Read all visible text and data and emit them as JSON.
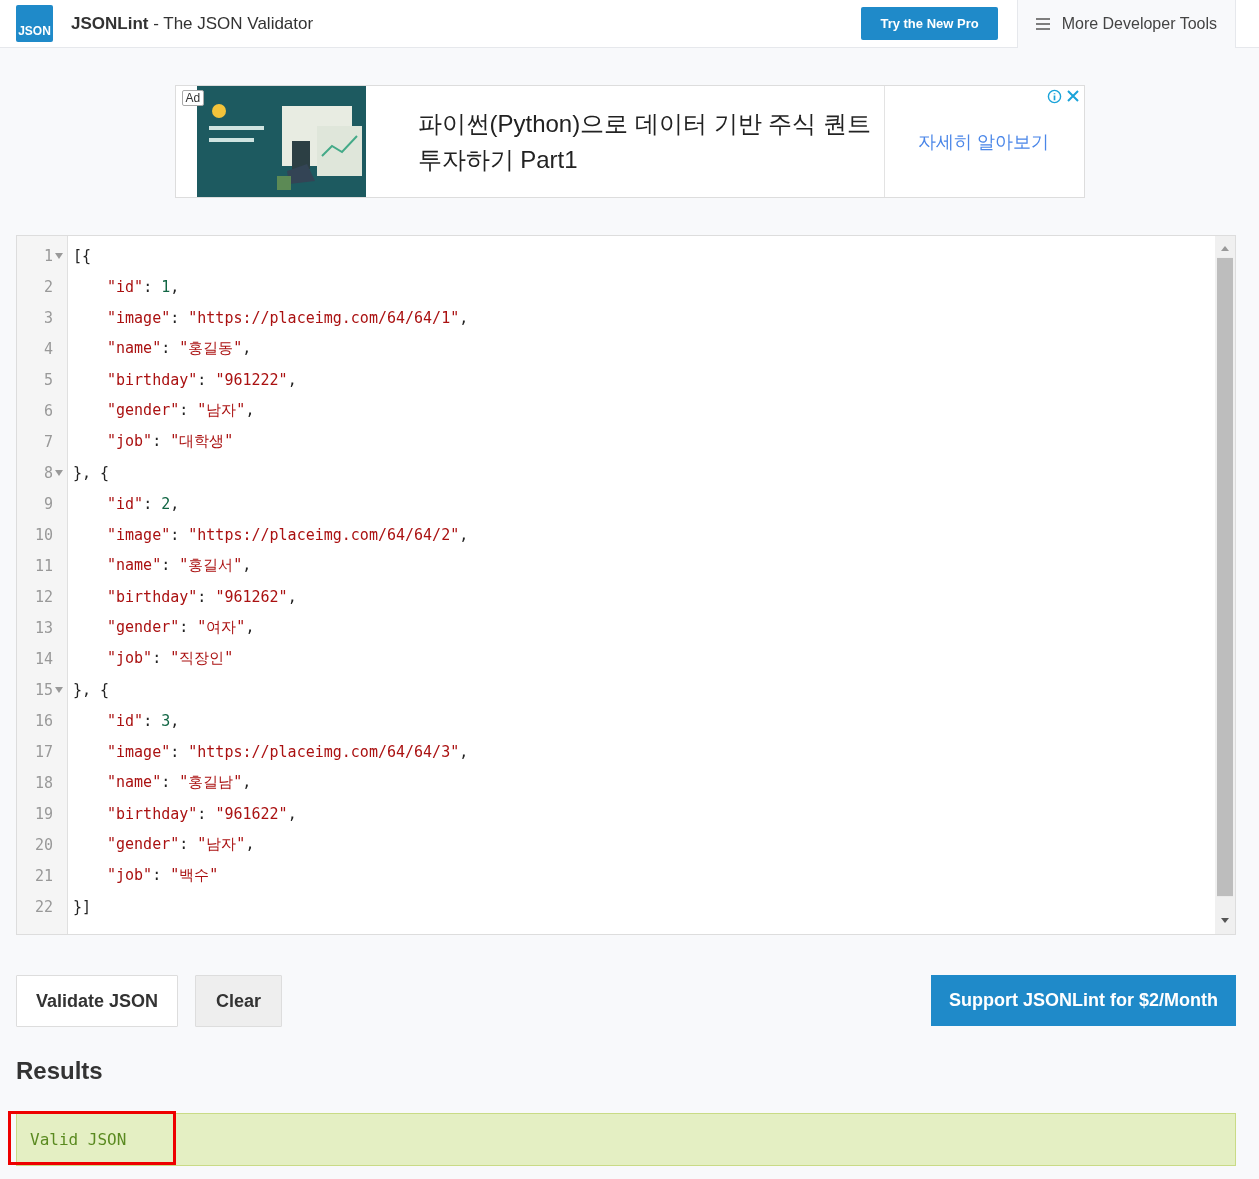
{
  "header": {
    "logo": "JSON",
    "brand": "JSONLint",
    "tagline": " - The JSON Validator",
    "pro_button": "Try the New Pro",
    "tools_button": "More Developer Tools"
  },
  "ad": {
    "badge": "Ad",
    "kind": "picture",
    "title": "파이썬(Python)으로 데이터 기반 주식 퀀트 투자하기 Part1",
    "link": "자세히 알아보기"
  },
  "editor": {
    "lines": [
      {
        "number": "1",
        "fold": true,
        "kind": "bracket",
        "tokens": [
          {
            "kind": "punct",
            "text": "[{"
          }
        ]
      },
      {
        "number": "2",
        "fold": false,
        "kind": "property",
        "tokens": [
          {
            "kind": "key",
            "text": "\"id\""
          },
          {
            "kind": "punct",
            "text": ": "
          },
          {
            "kind": "number",
            "text": "1"
          },
          {
            "kind": "punct",
            "text": ","
          }
        ]
      },
      {
        "number": "3",
        "fold": false,
        "kind": "property",
        "tokens": [
          {
            "kind": "key",
            "text": "\"image\""
          },
          {
            "kind": "punct",
            "text": ": "
          },
          {
            "kind": "string",
            "text": "\"https://placeimg.com/64/64/1\""
          },
          {
            "kind": "punct",
            "text": ","
          }
        ]
      },
      {
        "number": "4",
        "fold": false,
        "kind": "property",
        "tokens": [
          {
            "kind": "key",
            "text": "\"name\""
          },
          {
            "kind": "punct",
            "text": ": "
          },
          {
            "kind": "string",
            "text": "\"홍길동\""
          },
          {
            "kind": "punct",
            "text": ","
          }
        ]
      },
      {
        "number": "5",
        "fold": false,
        "kind": "property",
        "tokens": [
          {
            "kind": "key",
            "text": "\"birthday\""
          },
          {
            "kind": "punct",
            "text": ": "
          },
          {
            "kind": "string",
            "text": "\"961222\""
          },
          {
            "kind": "punct",
            "text": ","
          }
        ]
      },
      {
        "number": "6",
        "fold": false,
        "kind": "property",
        "tokens": [
          {
            "kind": "key",
            "text": "\"gender\""
          },
          {
            "kind": "punct",
            "text": ": "
          },
          {
            "kind": "string",
            "text": "\"남자\""
          },
          {
            "kind": "punct",
            "text": ","
          }
        ]
      },
      {
        "number": "7",
        "fold": false,
        "kind": "property",
        "tokens": [
          {
            "kind": "key",
            "text": "\"job\""
          },
          {
            "kind": "punct",
            "text": ": "
          },
          {
            "kind": "string",
            "text": "\"대학생\""
          }
        ]
      },
      {
        "number": "8",
        "fold": true,
        "kind": "bracket",
        "tokens": [
          {
            "kind": "punct",
            "text": "}, {"
          }
        ]
      },
      {
        "number": "9",
        "fold": false,
        "kind": "property",
        "tokens": [
          {
            "kind": "key",
            "text": "\"id\""
          },
          {
            "kind": "punct",
            "text": ": "
          },
          {
            "kind": "number",
            "text": "2"
          },
          {
            "kind": "punct",
            "text": ","
          }
        ]
      },
      {
        "number": "10",
        "fold": false,
        "kind": "property",
        "tokens": [
          {
            "kind": "key",
            "text": "\"image\""
          },
          {
            "kind": "punct",
            "text": ": "
          },
          {
            "kind": "string",
            "text": "\"https://placeimg.com/64/64/2\""
          },
          {
            "kind": "punct",
            "text": ","
          }
        ]
      },
      {
        "number": "11",
        "fold": false,
        "kind": "property",
        "tokens": [
          {
            "kind": "key",
            "text": "\"name\""
          },
          {
            "kind": "punct",
            "text": ": "
          },
          {
            "kind": "string",
            "text": "\"홍길서\""
          },
          {
            "kind": "punct",
            "text": ","
          }
        ]
      },
      {
        "number": "12",
        "fold": false,
        "kind": "property",
        "tokens": [
          {
            "kind": "key",
            "text": "\"birthday\""
          },
          {
            "kind": "punct",
            "text": ": "
          },
          {
            "kind": "string",
            "text": "\"961262\""
          },
          {
            "kind": "punct",
            "text": ","
          }
        ]
      },
      {
        "number": "13",
        "fold": false,
        "kind": "property",
        "tokens": [
          {
            "kind": "key",
            "text": "\"gender\""
          },
          {
            "kind": "punct",
            "text": ": "
          },
          {
            "kind": "string",
            "text": "\"여자\""
          },
          {
            "kind": "punct",
            "text": ","
          }
        ]
      },
      {
        "number": "14",
        "fold": false,
        "kind": "property",
        "tokens": [
          {
            "kind": "key",
            "text": "\"job\""
          },
          {
            "kind": "punct",
            "text": ": "
          },
          {
            "kind": "string",
            "text": "\"직장인\""
          }
        ]
      },
      {
        "number": "15",
        "fold": true,
        "kind": "bracket",
        "tokens": [
          {
            "kind": "punct",
            "text": "}, {"
          }
        ]
      },
      {
        "number": "16",
        "fold": false,
        "kind": "property",
        "tokens": [
          {
            "kind": "key",
            "text": "\"id\""
          },
          {
            "kind": "punct",
            "text": ": "
          },
          {
            "kind": "number",
            "text": "3"
          },
          {
            "kind": "punct",
            "text": ","
          }
        ]
      },
      {
        "number": "17",
        "fold": false,
        "kind": "property",
        "tokens": [
          {
            "kind": "key",
            "text": "\"image\""
          },
          {
            "kind": "punct",
            "text": ": "
          },
          {
            "kind": "string",
            "text": "\"https://placeimg.com/64/64/3\""
          },
          {
            "kind": "punct",
            "text": ","
          }
        ]
      },
      {
        "number": "18",
        "fold": false,
        "kind": "property",
        "tokens": [
          {
            "kind": "key",
            "text": "\"name\""
          },
          {
            "kind": "punct",
            "text": ": "
          },
          {
            "kind": "string",
            "text": "\"홍길남\""
          },
          {
            "kind": "punct",
            "text": ","
          }
        ]
      },
      {
        "number": "19",
        "fold": false,
        "kind": "property",
        "tokens": [
          {
            "kind": "key",
            "text": "\"birthday\""
          },
          {
            "kind": "punct",
            "text": ": "
          },
          {
            "kind": "string",
            "text": "\"961622\""
          },
          {
            "kind": "punct",
            "text": ","
          }
        ]
      },
      {
        "number": "20",
        "fold": false,
        "kind": "property",
        "tokens": [
          {
            "kind": "key",
            "text": "\"gender\""
          },
          {
            "kind": "punct",
            "text": ": "
          },
          {
            "kind": "string",
            "text": "\"남자\""
          },
          {
            "kind": "punct",
            "text": ","
          }
        ]
      },
      {
        "number": "21",
        "fold": false,
        "kind": "property",
        "tokens": [
          {
            "kind": "key",
            "text": "\"job\""
          },
          {
            "kind": "punct",
            "text": ": "
          },
          {
            "kind": "string",
            "text": "\"백수\""
          }
        ]
      },
      {
        "number": "22",
        "fold": false,
        "kind": "bracket",
        "tokens": [
          {
            "kind": "punct",
            "text": "}]"
          }
        ]
      }
    ]
  },
  "actions": {
    "validate": "Validate JSON",
    "clear": "Clear",
    "support": "Support JSONLint for $2/Month"
  },
  "results": {
    "heading": "Results",
    "message": "Valid JSON",
    "highlighted": true
  }
}
